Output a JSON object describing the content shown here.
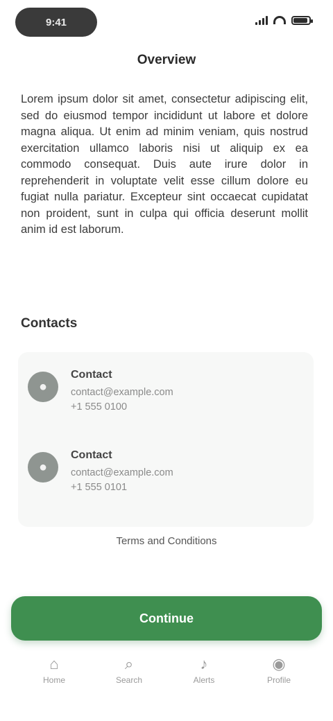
{
  "status": {
    "time": "9:41",
    "battery_level": 0.9,
    "signal_bars": 4
  },
  "header": {
    "title": "Overview"
  },
  "description": "Lorem ipsum dolor sit amet, consectetur adipiscing elit, sed do eiusmod tempor incididunt ut labore et dolore magna aliqua. Ut enim ad minim veniam, quis nostrud exercitation ullamco laboris nisi ut aliquip ex ea commodo consequat. Duis aute irure dolor in reprehenderit in voluptate velit esse cillum dolore eu fugiat nulla pariatur. Excepteur sint occaecat cupidatat non proident, sunt in culpa qui officia deserunt mollit anim id est laborum.",
  "section": {
    "heading": "Contacts"
  },
  "cards": [
    {
      "icon": "user-icon",
      "name": "Contact",
      "line1": "contact@example.com",
      "line2": "+1 555 0100"
    },
    {
      "icon": "user-icon",
      "name": "Contact",
      "line1": "contact@example.com",
      "line2": "+1 555 0101"
    }
  ],
  "footer_link": "Terms and Conditions",
  "primary_button": {
    "label": "Continue"
  },
  "nav": [
    {
      "icon": "home-icon",
      "glyph": "⌂",
      "label": "Home"
    },
    {
      "icon": "search-icon",
      "glyph": "⌕",
      "label": "Search"
    },
    {
      "icon": "bell-icon",
      "glyph": "♪",
      "label": "Alerts"
    },
    {
      "icon": "profile-icon",
      "glyph": "◉",
      "label": "Profile"
    }
  ],
  "colors": {
    "accent": "#3f8f50",
    "card_bg": "#f7f8f7",
    "avatar": "#8f9591"
  }
}
